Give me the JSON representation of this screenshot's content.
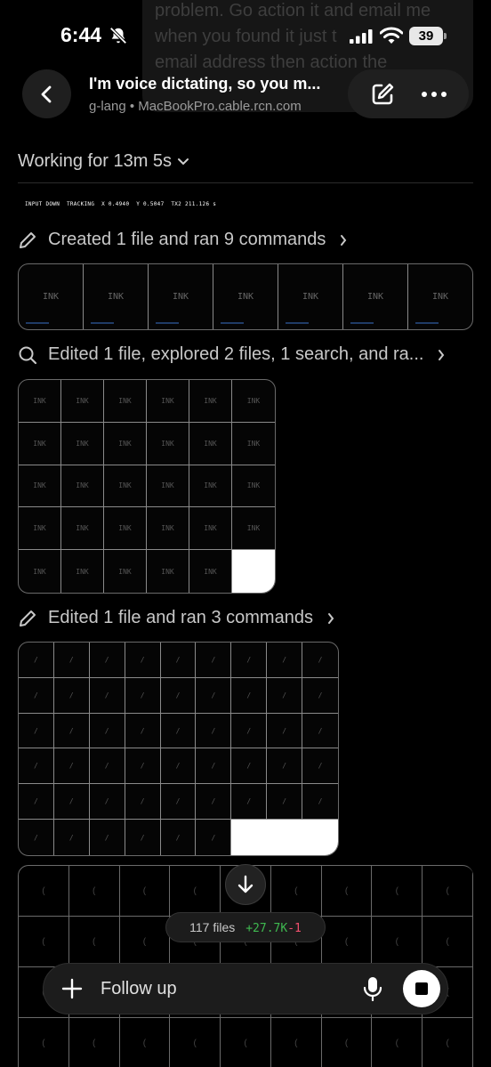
{
  "previous_message": {
    "lines": [
      "problem. Go action it and email me",
      "when you found it just t",
      "email address then action the",
      "              "
    ]
  },
  "status_bar": {
    "time": "6:44",
    "battery": "39",
    "icons": [
      "bell-slash-icon",
      "cellular-signal-icon",
      "wifi-icon",
      "battery-icon"
    ]
  },
  "header": {
    "title": "I'm voice dictating, so you m...",
    "subtitle": "g-lang • MacBookPro.cable.rcn.com",
    "icons": [
      "back-icon",
      "compose-icon",
      "more-icon"
    ]
  },
  "working": {
    "label": "Working for 13m 5s"
  },
  "tracking_text": "INPUT DOWN  TRACKING  X 0.4940  Y 0.5047  TX2 211.126 s",
  "steps": [
    {
      "icon": "pencil-icon",
      "label": "Created 1 file and ran 9 commands"
    },
    {
      "icon": "search-icon",
      "label": "Edited 1 file, explored 2 files, 1 search, and ra..."
    },
    {
      "icon": "pencil-icon",
      "label": "Edited 1 file and ran 3 commands"
    }
  ],
  "strip_cells": [
    "INK",
    "INK",
    "INK",
    "INK",
    "INK",
    "INK",
    "INK"
  ],
  "grid_cell_label": "INK",
  "stroke_glyph": "/",
  "bottom_glyph": "(",
  "diff": {
    "files": "117 files",
    "added": "+27.7K",
    "removed": "-1"
  },
  "composer": {
    "placeholder": "Follow up"
  },
  "colors": {
    "added": "#3fb950",
    "removed": "#f0506e",
    "background": "#000000"
  }
}
